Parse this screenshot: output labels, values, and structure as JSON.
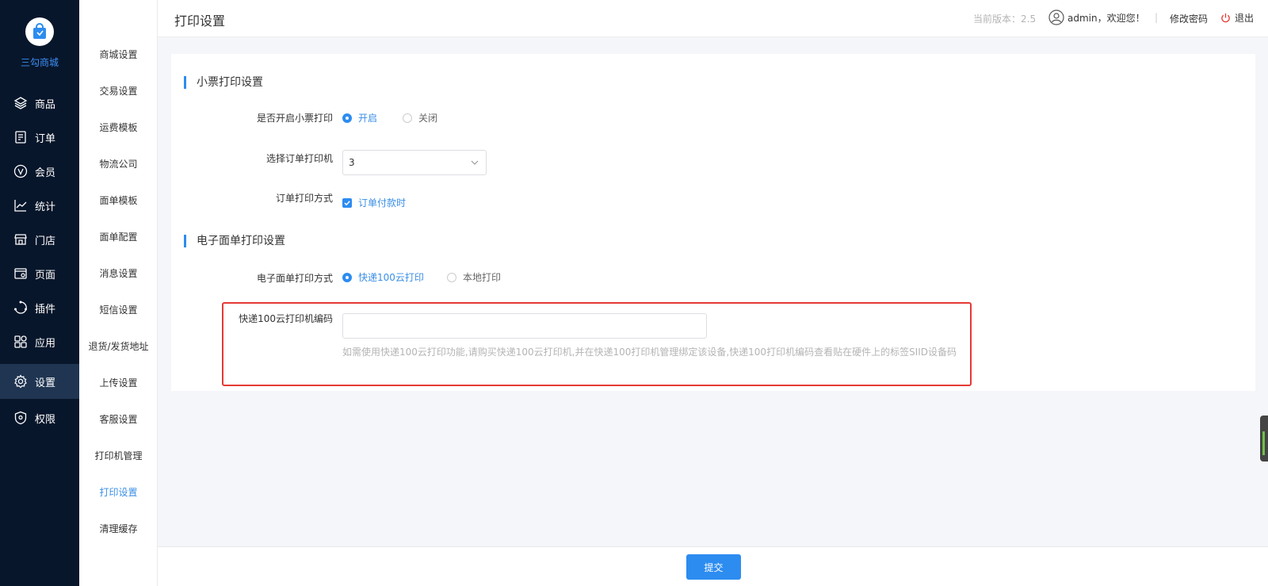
{
  "app": {
    "logo_name": "三勾商城"
  },
  "nav": {
    "items": [
      {
        "label": "商品",
        "icon": "layers-icon"
      },
      {
        "label": "订单",
        "icon": "order-document-icon"
      },
      {
        "label": "会员",
        "icon": "member-v-icon"
      },
      {
        "label": "统计",
        "icon": "line-chart-icon"
      },
      {
        "label": "门店",
        "icon": "store-icon"
      },
      {
        "label": "页面",
        "icon": "page-icon"
      },
      {
        "label": "插件",
        "icon": "plugin-icon"
      },
      {
        "label": "应用",
        "icon": "apps-grid-icon"
      },
      {
        "label": "设置",
        "icon": "gear-icon",
        "active": true
      },
      {
        "label": "权限",
        "icon": "shield-icon"
      }
    ]
  },
  "submenu": {
    "items": [
      "商城设置",
      "交易设置",
      "运费模板",
      "物流公司",
      "面单模板",
      "面单配置",
      "消息设置",
      "短信设置",
      "退货/发货地址",
      "上传设置",
      "客服设置",
      "打印机管理",
      "打印设置",
      "清理缓存"
    ],
    "active": "打印设置"
  },
  "header": {
    "title": "打印设置",
    "version": "当前版本：2.5",
    "user": "admin，欢迎您！",
    "separator": "|",
    "change_password": "修改密码",
    "logout": "退出"
  },
  "ticket": {
    "section_title": "小票打印设置",
    "enable_label": "是否开启小票打印",
    "enable_on": "开启",
    "enable_off": "关闭",
    "enable_value": "开启",
    "printer_label": "选择订单打印机",
    "printer_value": "3",
    "method_label": "订单打印方式",
    "method_option": "订单付款时",
    "method_checked": true
  },
  "waybill": {
    "section_title": "电子面单打印设置",
    "method_label": "电子面单打印方式",
    "option_cloud": "快递100云打印",
    "option_local": "本地打印",
    "method_value": "快递100云打印",
    "code_label": "快递100云打印机编码",
    "code_value": "",
    "code_hint": "如需使用快递100云打印功能,请购买快递100云打印机,并在快递100打印机管理绑定该设备,快递100打印机编码查看贴在硬件上的标签SIID设备码"
  },
  "footer": {
    "submit_label": "提交"
  },
  "colors": {
    "accent": "#2d8cf0",
    "sidebar": "#08162b",
    "highlight": "#e53935"
  }
}
